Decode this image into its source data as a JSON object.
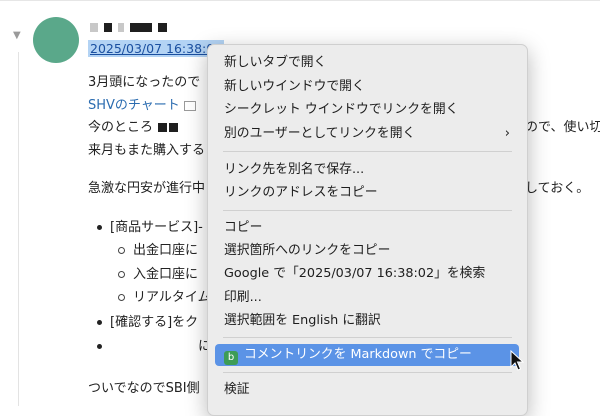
{
  "post": {
    "timestamp": "2025/03/07 16:38:02",
    "collapse_glyph": "▼",
    "lines": [
      "3月頭になったので",
      "SHVのチャート",
      "今のところ",
      "来月もまた購入する"
    ],
    "paragraph2": "急激な円安が進行中",
    "right_fragment_1": "ので、使い切",
    "right_fragment_2": "しておく。",
    "bullets": [
      {
        "level": 1,
        "text": "[商品サービス]-"
      },
      {
        "level": 2,
        "text": "出金口座に"
      },
      {
        "level": 2,
        "text": "入金口座に"
      },
      {
        "level": 2,
        "text": "リアルタイム"
      },
      {
        "level": 1,
        "text": "[確認する]をク"
      },
      {
        "level": 1,
        "text": ""
      }
    ],
    "bullet_tail": "に",
    "footer_line": "ついでなのでSBI側"
  },
  "context_menu": {
    "items": [
      {
        "label": "新しいタブで開く"
      },
      {
        "label": "新しいウインドウで開く"
      },
      {
        "label": "シークレット ウインドウでリンクを開く"
      },
      {
        "label": "別のユーザーとしてリンクを開く",
        "submenu_glyph": "›"
      },
      {
        "label": "リンク先を別名で保存..."
      },
      {
        "label": "リンクのアドレスをコピー"
      },
      {
        "label": "コピー"
      },
      {
        "label": "選択箇所へのリンクをコピー"
      },
      {
        "label": "Google で「2025/03/07 16:38:02」を検索"
      },
      {
        "label": "印刷..."
      },
      {
        "label": "選択範囲を English に翻訳"
      },
      {
        "label": "コメントリンクを Markdown でコピー",
        "icon_glyph": "b",
        "highlighted": true
      },
      {
        "label": "検証"
      }
    ]
  },
  "colors": {
    "avatar": "#5aa88a",
    "menu_highlight": "#5b93e6",
    "selection": "#b3d3f4",
    "link": "#2b6cb0",
    "extension_icon": "#3d9c56"
  }
}
